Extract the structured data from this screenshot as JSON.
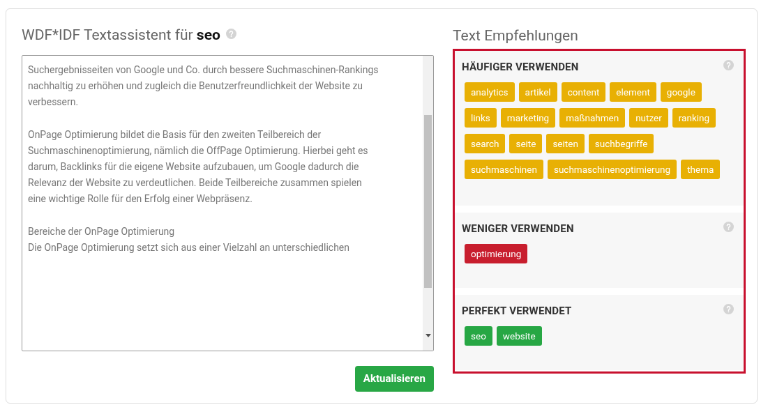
{
  "editor": {
    "title": "WDF*IDF Textassistent für",
    "keyword": "seo",
    "paragraphs": [
      [
        "Suchergebnisseiten von Google und Co. durch bessere Suchmaschinen-Rankings",
        "nachhaltig zu erhöhen und zugleich die Benutzerfreundlichkeit der Website zu",
        "verbessern."
      ],
      [
        "OnPage Optimierung bildet die Basis für den zweiten Teilbereich der",
        "Suchmaschinenoptimierung, nämlich die OffPage Optimierung. Hierbei geht es",
        "darum, Backlinks für die eigene Website aufzubauen, um Google dadurch die",
        "Relevanz der Website zu verdeutlichen. Beide Teilbereiche zusammen spielen",
        "eine wichtige Rolle für den Erfolg einer Webpräsenz."
      ],
      [
        "Bereiche der OnPage Optimierung",
        "Die OnPage Optimierung setzt sich aus einer Vielzahl an unterschiedlichen"
      ]
    ],
    "button": "Aktualisieren"
  },
  "recommendations": {
    "title": "Text Empfehlungen",
    "groups": [
      {
        "kind": "more",
        "title": "HÄUFIGER VERWENDEN",
        "tags": [
          "analytics",
          "artikel",
          "content",
          "element",
          "google",
          "links",
          "marketing",
          "maßnahmen",
          "nutzer",
          "ranking",
          "search",
          "seite",
          "seiten",
          "suchbegriffe",
          "suchmaschinen",
          "suchmaschinenoptimierung",
          "thema"
        ]
      },
      {
        "kind": "less",
        "title": "WENIGER VERWENDEN",
        "tags": [
          "optimierung"
        ]
      },
      {
        "kind": "perfect",
        "title": "PERFEKT VERWENDET",
        "tags": [
          "seo",
          "website"
        ]
      }
    ]
  }
}
